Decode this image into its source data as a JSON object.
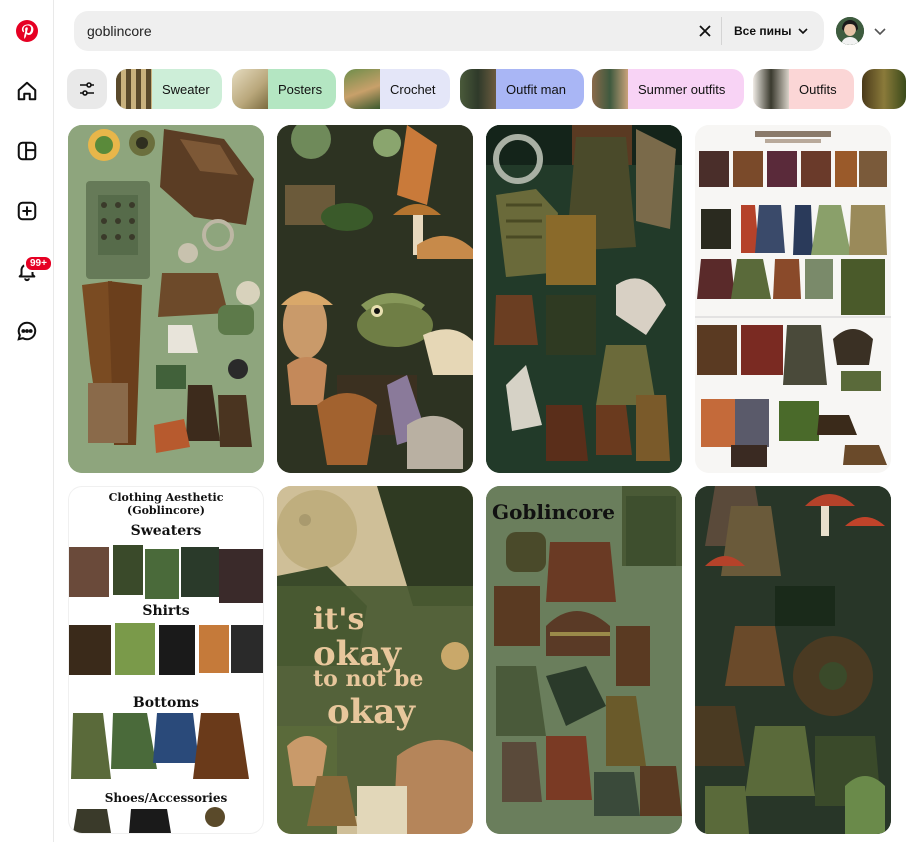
{
  "sidebar": {
    "notifications_badge": "99+",
    "icons": [
      "pinterest-logo",
      "home-icon",
      "boards-icon",
      "create-icon",
      "bell-icon",
      "messages-icon"
    ]
  },
  "search": {
    "value": "goblincore",
    "scope_label": "Все пины"
  },
  "chips": [
    {
      "label": "Sweater",
      "color": "#cdeed8"
    },
    {
      "label": "Posters",
      "color": "#b4e6c2"
    },
    {
      "label": "Crochet",
      "color": "#e4e6f8"
    },
    {
      "label": "Outfit man",
      "color": "#a9b6f5"
    },
    {
      "label": "Summer outfits",
      "color": "#f8d3f5"
    },
    {
      "label": "Outfits",
      "color": "#fbd6d6"
    }
  ],
  "pins": {
    "clothing_title": "Clothing Aesthetic (Goblincore)",
    "clothing_sections": [
      "Sweaters",
      "Shirts",
      "Bottoms",
      "Shoes/Accessories"
    ],
    "goblincore_title": "Goblincore",
    "okay_lines": [
      "it's",
      "okay",
      "to not be",
      "okay"
    ]
  },
  "colors": {
    "brand": "#e60023",
    "chip_bg": "#e9e9e9",
    "search_bg": "#efefef"
  }
}
